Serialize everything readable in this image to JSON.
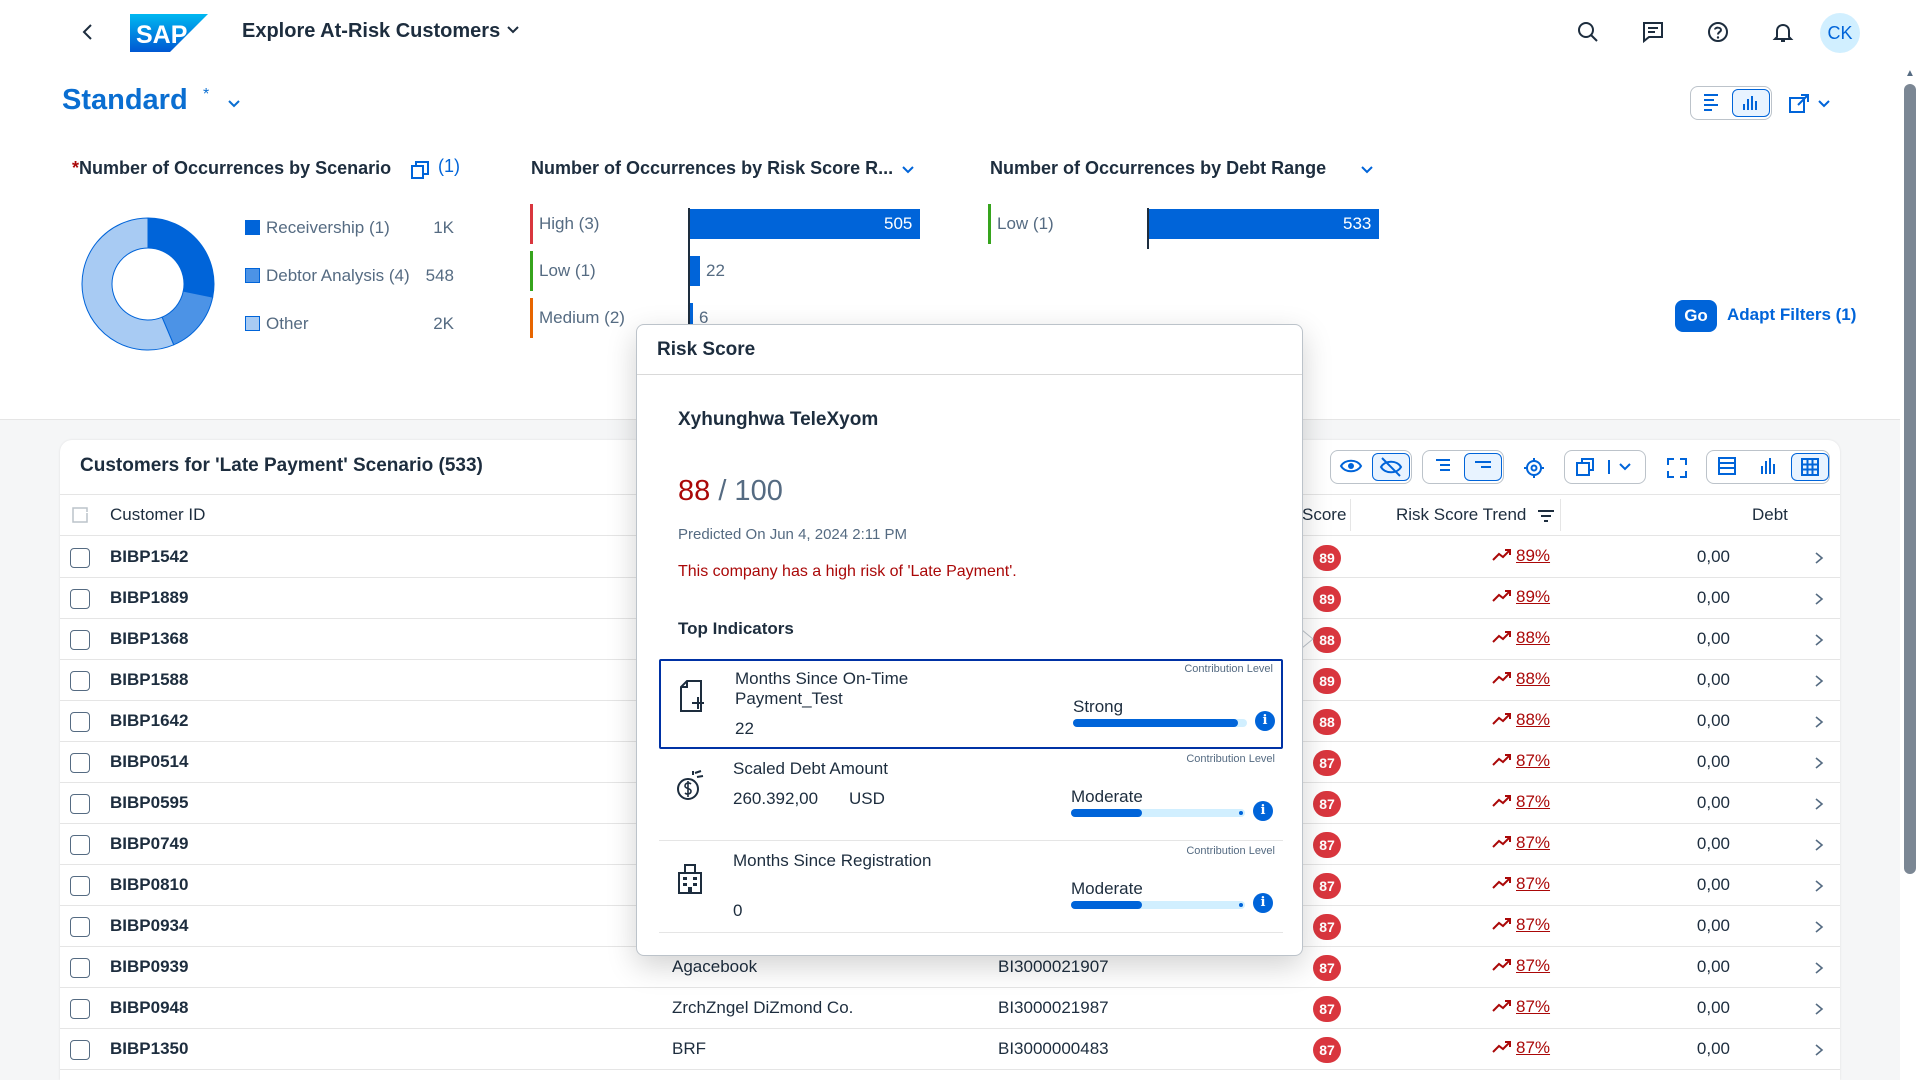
{
  "shell": {
    "app_title": "Explore At-Risk Customers",
    "logo_text": "SAP",
    "avatar_initials": "CK"
  },
  "header": {
    "variant_name": "Standard",
    "variant_modified_marker": "*",
    "go_label": "Go",
    "adapt_filters_label": "Adapt Filters (1)"
  },
  "charts": {
    "scenario": {
      "required_marker": "*",
      "title": "Number of Occurrences by Scenario",
      "selection_count": "(1)",
      "legend": [
        {
          "label": "Receivership (1)",
          "value": "1K",
          "color": "#0064d9"
        },
        {
          "label": "Debtor Analysis (4)",
          "value": "548",
          "color": "#4c93e6"
        },
        {
          "label": "Other",
          "value": "2K",
          "color": "#a8cbf3"
        }
      ]
    },
    "risk_score_range": {
      "title": "Number of Occurrences by Risk Score R...",
      "rows": [
        {
          "label": "High (3)",
          "value": "505",
          "color": "#d9363e"
        },
        {
          "label": "Low (1)",
          "value": "22",
          "color": "#36a41d"
        },
        {
          "label": "Medium (2)",
          "value": "6",
          "color": "#e76500"
        }
      ]
    },
    "debt_range": {
      "title": "Number of Occurrences by Debt Range",
      "rows": [
        {
          "label": "Low (1)",
          "value": "533",
          "color": "#36a41d"
        }
      ]
    }
  },
  "chart_data": [
    {
      "type": "pie",
      "title": "Number of Occurrences by Scenario",
      "categories": [
        "Receivership (1)",
        "Debtor Analysis (4)",
        "Other"
      ],
      "values": [
        1000,
        548,
        2000
      ]
    },
    {
      "type": "bar",
      "title": "Number of Occurrences by Risk Score R...",
      "categories": [
        "High (3)",
        "Low (1)",
        "Medium (2)"
      ],
      "values": [
        505,
        22,
        6
      ]
    },
    {
      "type": "bar",
      "title": "Number of Occurrences by Debt Range",
      "categories": [
        "Low (1)"
      ],
      "values": [
        533
      ]
    }
  ],
  "table": {
    "title": "Customers for 'Late Payment' Scenario (533)",
    "columns": {
      "customer_id": "Customer ID",
      "score": "Score",
      "risk_score_trend": "Risk Score Trend",
      "debt": "Debt"
    },
    "rows": [
      {
        "id": "BIBP1542",
        "name": "",
        "ref": "",
        "score": "89",
        "trend": "89%",
        "debt": "0,00"
      },
      {
        "id": "BIBP1889",
        "name": "",
        "ref": "",
        "score": "89",
        "trend": "89%",
        "debt": "0,00"
      },
      {
        "id": "BIBP1368",
        "name": "",
        "ref": "",
        "score": "88",
        "trend": "88%",
        "debt": "0,00"
      },
      {
        "id": "BIBP1588",
        "name": "",
        "ref": "",
        "score": "89",
        "trend": "88%",
        "debt": "0,00"
      },
      {
        "id": "BIBP1642",
        "name": "",
        "ref": "",
        "score": "88",
        "trend": "88%",
        "debt": "0,00"
      },
      {
        "id": "BIBP0514",
        "name": "",
        "ref": "",
        "score": "87",
        "trend": "87%",
        "debt": "0,00"
      },
      {
        "id": "BIBP0595",
        "name": "",
        "ref": "",
        "score": "87",
        "trend": "87%",
        "debt": "0,00"
      },
      {
        "id": "BIBP0749",
        "name": "",
        "ref": "",
        "score": "87",
        "trend": "87%",
        "debt": "0,00"
      },
      {
        "id": "BIBP0810",
        "name": "",
        "ref": "",
        "score": "87",
        "trend": "87%",
        "debt": "0,00"
      },
      {
        "id": "BIBP0934",
        "name": "",
        "ref": "",
        "score": "87",
        "trend": "87%",
        "debt": "0,00"
      },
      {
        "id": "BIBP0939",
        "name": "Agacebook",
        "ref": "BI3000021907",
        "score": "87",
        "trend": "87%",
        "debt": "0,00"
      },
      {
        "id": "BIBP0948",
        "name": "ZrchZngel DiZmond Co.",
        "ref": "BI3000021987",
        "score": "87",
        "trend": "87%",
        "debt": "0,00"
      },
      {
        "id": "BIBP1350",
        "name": "BRF",
        "ref": "BI3000000483",
        "score": "87",
        "trend": "87%",
        "debt": "0,00"
      }
    ]
  },
  "popover": {
    "title": "Risk Score",
    "company": "Xyhunghwa TeleXyom",
    "score": "88",
    "score_max": " / 100",
    "predicted": "Predicted On Jun 4, 2024 2:11 PM",
    "risk_message": "This company has a high risk of 'Late Payment'.",
    "top_indicators_label": "Top Indicators",
    "indicators": [
      {
        "label": "Months Since On-Time Payment_Test",
        "value": "22",
        "unit": "",
        "contribution_label": "Contribution Level",
        "level": "Strong",
        "level_fraction": 0.95,
        "icon": "document-add-icon"
      },
      {
        "label": "Scaled Debt Amount",
        "value": "260.392,00",
        "unit": "USD",
        "contribution_label": "Contribution Level",
        "level": "Moderate",
        "level_fraction": 0.41,
        "icon": "money-icon"
      },
      {
        "label": "Months Since Registration",
        "value": "0",
        "unit": "",
        "contribution_label": "Contribution Level",
        "level": "Moderate",
        "level_fraction": 0.41,
        "icon": "building-icon"
      }
    ]
  }
}
